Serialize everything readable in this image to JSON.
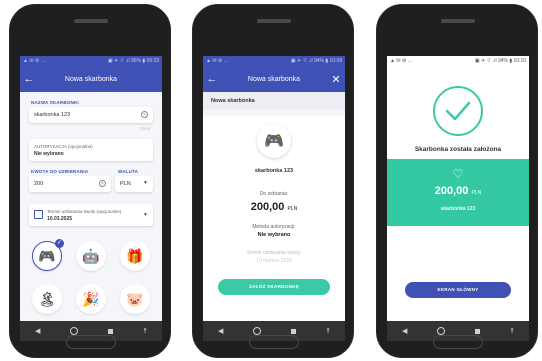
{
  "phone1": {
    "status": {
      "left": "▲ ✉ ⚙ …",
      "right": "▣ ✈ ⌔ .ıl 95% ▮ 09:23"
    },
    "appbar": {
      "title": "Nowa skarbonka"
    },
    "name_label": "NAZWA SKARBONKI",
    "name_value": "skarbonka 123",
    "name_counter": "13/15",
    "auth_label": "AUTORYZACJA (opcjonalne)",
    "auth_value": "Nie wybrano",
    "amount_label": "KWOTA DO UZBIERANIA",
    "amount_value": "200",
    "currency_label": "WALUTA",
    "currency_value": "PLN",
    "deadline_label": "Termin uzbierania kwoty (opcjonalne)",
    "deadline_value": "10.03.2025",
    "stickers": [
      "game-controller-icon",
      "robot-icon",
      "gift-icon",
      "island-icon",
      "party-popper-icon",
      "piggy-bank-icon"
    ]
  },
  "phone2": {
    "status": {
      "left": "▲ ✉ ⚙ …",
      "right": "▣ ✈ ⌔ .ıl 94% ▮ 10:09"
    },
    "appbar": {
      "title": "Nowa skarbonka"
    },
    "section_title": "Nowa skarbonka",
    "name": "skarbonka 123",
    "goal_label": "Do zebrania:",
    "goal_amount": "200,00",
    "goal_currency": "PLN",
    "auth_label": "Metoda autoryzacji:",
    "auth_value": "Nie wybrano",
    "deadline_label": "Termin uzbierania kwoty:",
    "deadline_value": "10 marzec 2025",
    "create_button": "ZAŁÓŻ SKARBONKĘ"
  },
  "phone3": {
    "status": {
      "left": "▲ ✉ ⚙ …",
      "right": "▣ ✈ ⌔ .ıl 34% ▮ 10:10"
    },
    "success_text": "Skarbonka została założona",
    "amount": "200,00",
    "currency": "PLN",
    "name": "skarbonka 123",
    "home_button": "EKRAN GŁÓWNY"
  }
}
